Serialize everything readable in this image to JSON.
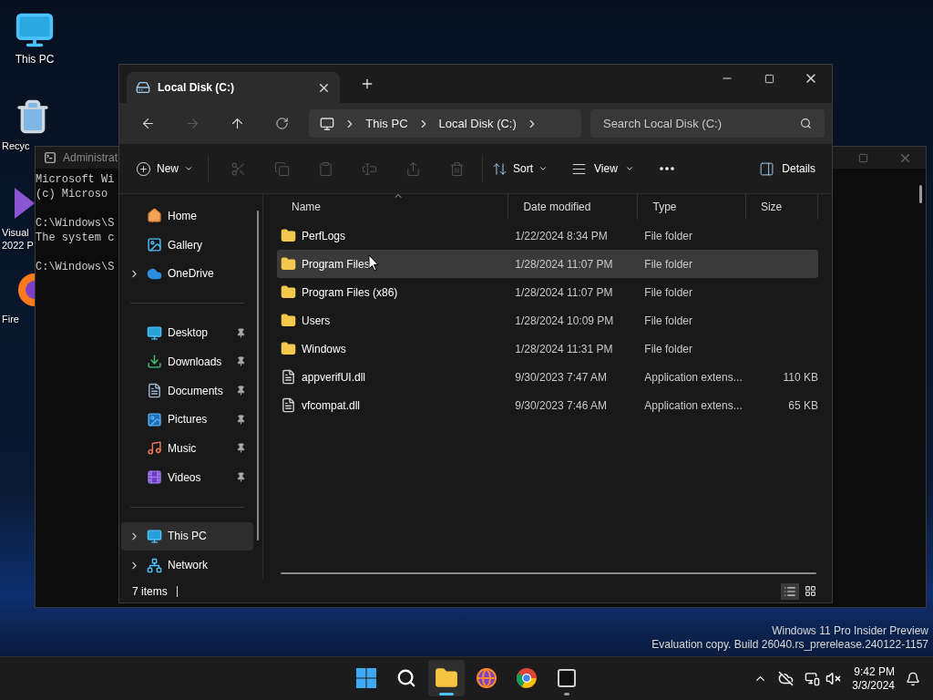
{
  "desktop_icons": [
    {
      "lines": [
        "This PC"
      ],
      "kind": "monitor"
    },
    {
      "lines": [
        "Recyc"
      ],
      "kind": "recycle"
    },
    {
      "lines": [
        "Visual",
        "2022 P"
      ],
      "kind": "vs"
    },
    {
      "lines": [
        "Fire"
      ],
      "kind": "firefox"
    }
  ],
  "console": {
    "title": "Administrat",
    "blocks": [
      [
        "Microsoft Wi",
        "(c) Microso"
      ],
      [
        "C:\\Windows\\S",
        "The system c"
      ],
      [
        "C:\\Windows\\S"
      ]
    ]
  },
  "explorer": {
    "tabs": [
      {
        "title": "Local Disk (C:)",
        "selected": true
      }
    ],
    "address": {
      "crumbs": [
        "This PC",
        "Local Disk (C:)"
      ]
    },
    "search": {
      "placeholder": "Search Local Disk (C:)"
    },
    "toolbar": {
      "new": "New",
      "sort": "Sort",
      "view": "View",
      "details": "Details",
      "actions": [
        {
          "kind": "cut",
          "disabled": true
        },
        {
          "kind": "copy",
          "disabled": true
        },
        {
          "kind": "paste",
          "disabled": true
        },
        {
          "kind": "rename",
          "disabled": true
        },
        {
          "kind": "share",
          "disabled": true
        },
        {
          "kind": "delete",
          "disabled": true
        }
      ]
    },
    "sidebar": {
      "sections": [
        [
          {
            "label": "Home",
            "kind": "home",
            "pinned": false,
            "expandable": false,
            "selected": false
          },
          {
            "label": "Gallery",
            "kind": "gallery",
            "pinned": false,
            "expandable": false,
            "selected": false
          },
          {
            "label": "OneDrive",
            "kind": "cloud",
            "pinned": false,
            "expandable": true,
            "selected": false
          }
        ],
        [
          {
            "label": "Desktop",
            "kind": "desktop",
            "pinned": true,
            "expandable": false,
            "selected": false
          },
          {
            "label": "Downloads",
            "kind": "download",
            "pinned": true,
            "expandable": false,
            "selected": false
          },
          {
            "label": "Documents",
            "kind": "document",
            "pinned": true,
            "expandable": false,
            "selected": false
          },
          {
            "label": "Pictures",
            "kind": "picture",
            "pinned": true,
            "expandable": false,
            "selected": false
          },
          {
            "label": "Music",
            "kind": "music",
            "pinned": true,
            "expandable": false,
            "selected": false
          },
          {
            "label": "Videos",
            "kind": "video",
            "pinned": true,
            "expandable": false,
            "selected": false
          }
        ],
        [
          {
            "label": "This PC",
            "kind": "pc",
            "pinned": false,
            "expandable": true,
            "selected": true
          },
          {
            "label": "Network",
            "kind": "network",
            "pinned": false,
            "expandable": true,
            "selected": false
          }
        ]
      ]
    },
    "columns": [
      {
        "label": "Name",
        "sorted": true
      },
      {
        "label": "Date modified",
        "sorted": false
      },
      {
        "label": "Type",
        "sorted": false
      },
      {
        "label": "Size",
        "sorted": false
      }
    ],
    "rows": [
      {
        "name": "PerfLogs",
        "date": "1/22/2024 8:34 PM",
        "type": "File folder",
        "size": "",
        "kind": "folder",
        "selected": false
      },
      {
        "name": "Program Files",
        "date": "1/28/2024 11:07 PM",
        "type": "File folder",
        "size": "",
        "kind": "folder",
        "selected": true
      },
      {
        "name": "Program Files (x86)",
        "date": "1/28/2024 11:07 PM",
        "type": "File folder",
        "size": "",
        "kind": "folder",
        "selected": false
      },
      {
        "name": "Users",
        "date": "1/28/2024 10:09 PM",
        "type": "File folder",
        "size": "",
        "kind": "folder",
        "selected": false
      },
      {
        "name": "Windows",
        "date": "1/28/2024 11:31 PM",
        "type": "File folder",
        "size": "",
        "kind": "folder",
        "selected": false
      },
      {
        "name": "appverifUI.dll",
        "date": "9/30/2023 7:47 AM",
        "type": "Application extens...",
        "size": "110 KB",
        "kind": "file",
        "selected": false
      },
      {
        "name": "vfcompat.dll",
        "date": "9/30/2023 7:46 AM",
        "type": "Application extens...",
        "size": "65 KB",
        "kind": "file",
        "selected": false
      }
    ],
    "status": "7 items"
  },
  "build_info": [
    "Windows 11 Pro Insider Preview",
    "Evaluation copy. Build 26040.rs_prerelease.240122-1157"
  ],
  "taskbar": {
    "apps": [
      {
        "kind": "start",
        "active": false,
        "running": false
      },
      {
        "kind": "search",
        "active": false,
        "running": false
      },
      {
        "kind": "explorer",
        "active": true,
        "running": true
      },
      {
        "kind": "firefox",
        "active": false,
        "running": false
      },
      {
        "kind": "chrome",
        "active": false,
        "running": false
      },
      {
        "kind": "terminal",
        "active": false,
        "running": true
      }
    ],
    "time": "9:42 PM",
    "date": "3/3/2024"
  }
}
